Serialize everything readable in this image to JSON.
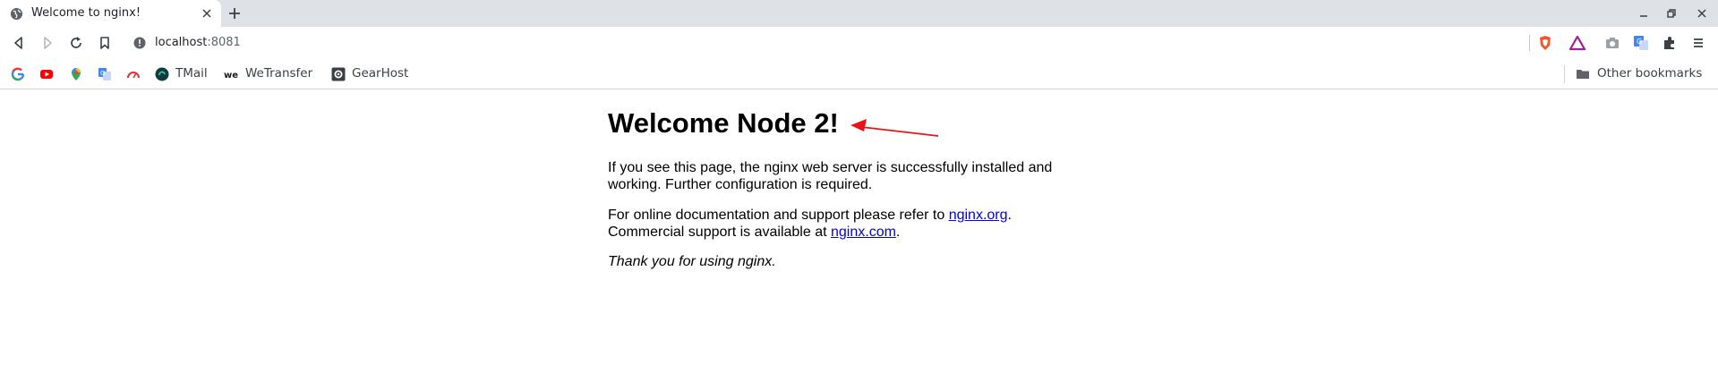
{
  "tab": {
    "title": "Welcome to nginx!",
    "favicon": "globe-icon"
  },
  "toolbar": {
    "url_host": "localhost",
    "url_port": ":8081"
  },
  "bookmarks": {
    "items": [
      {
        "label": "",
        "icon": "google-icon"
      },
      {
        "label": "",
        "icon": "youtube-icon"
      },
      {
        "label": "",
        "icon": "maps-icon"
      },
      {
        "label": "",
        "icon": "translate-icon"
      },
      {
        "label": "",
        "icon": "speedtest-icon"
      },
      {
        "label": "TMail",
        "icon": "tmail-icon"
      },
      {
        "label": "WeTransfer",
        "icon": "wetransfer-icon"
      },
      {
        "label": "GearHost",
        "icon": "gearhost-icon"
      }
    ],
    "other": "Other bookmarks"
  },
  "page": {
    "heading": "Welcome Node 2!",
    "p1": "If you see this page, the nginx web server is successfully installed and working. Further configuration is required.",
    "p2_prefix": "For online documentation and support please refer to ",
    "p2_link1": "nginx.org",
    "p2_mid": ".",
    "p2_line2": "Commercial support is available at ",
    "p2_link2": "nginx.com",
    "p2_end": ".",
    "p3": "Thank you for using nginx."
  },
  "colors": {
    "link": "#0000ee",
    "annotation_arrow": "#e8141a",
    "tabstrip_bg": "#dee1e6"
  }
}
